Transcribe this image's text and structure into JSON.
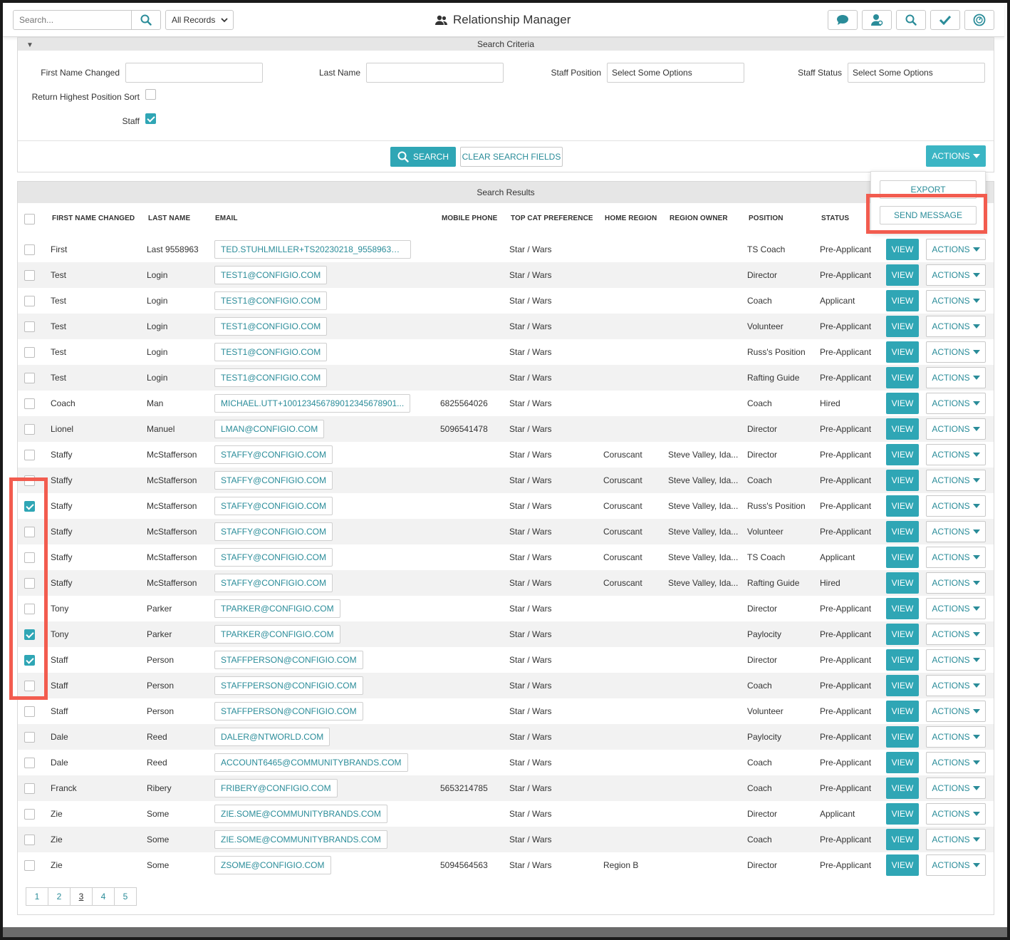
{
  "header": {
    "search_placeholder": "Search...",
    "records_select": "All Records",
    "title": "Relationship Manager",
    "icons": [
      "chat-icon",
      "user-icon",
      "search-icon",
      "check-icon",
      "dashboard-icon"
    ]
  },
  "criteria": {
    "title": "Search Criteria",
    "first_name_label": "First Name Changed",
    "first_name_value": "",
    "last_name_label": "Last Name",
    "last_name_value": "",
    "staff_position_label": "Staff Position",
    "staff_position_value": "Select Some Options",
    "staff_status_label": "Staff Status",
    "staff_status_value": "Select Some Options",
    "highest_position_label": "Return Highest Position Sort",
    "highest_position_checked": false,
    "staff_label": "Staff",
    "staff_checked": true,
    "search_button": "SEARCH",
    "clear_button": "CLEAR SEARCH FIELDS",
    "actions_button": "ACTIONS"
  },
  "actions_menu": {
    "export": "EXPORT",
    "send_message": "SEND MESSAGE"
  },
  "results": {
    "title": "Search Results",
    "columns": {
      "first_name": "FIRST NAME CHANGED",
      "last_name": "LAST NAME",
      "email": "EMAIL",
      "mobile": "MOBILE PHONE",
      "top_cat": "TOP CAT PREFERENCE",
      "home_region": "HOME REGION",
      "region_owner": "REGION OWNER",
      "position": "POSITION",
      "status": "STATUS"
    },
    "view_label": "VIEW",
    "actions_label": "ACTIONS",
    "rows": [
      {
        "checked": false,
        "first": "First",
        "last": "Last 9558963",
        "email": "TED.STUHLMILLER+TS20230218_9558963@C...",
        "mobile": "",
        "topcat": "Star / Wars",
        "region": "",
        "owner": "",
        "position": "TS Coach",
        "status": "Pre-Applicant"
      },
      {
        "checked": false,
        "first": "Test",
        "last": "Login",
        "email": "TEST1@CONFIGIO.COM",
        "mobile": "",
        "topcat": "Star / Wars",
        "region": "",
        "owner": "",
        "position": "Director",
        "status": "Pre-Applicant"
      },
      {
        "checked": false,
        "first": "Test",
        "last": "Login",
        "email": "TEST1@CONFIGIO.COM",
        "mobile": "",
        "topcat": "Star / Wars",
        "region": "",
        "owner": "",
        "position": "Coach",
        "status": "Applicant"
      },
      {
        "checked": false,
        "first": "Test",
        "last": "Login",
        "email": "TEST1@CONFIGIO.COM",
        "mobile": "",
        "topcat": "Star / Wars",
        "region": "",
        "owner": "",
        "position": "Volunteer",
        "status": "Pre-Applicant"
      },
      {
        "checked": false,
        "first": "Test",
        "last": "Login",
        "email": "TEST1@CONFIGIO.COM",
        "mobile": "",
        "topcat": "Star / Wars",
        "region": "",
        "owner": "",
        "position": "Russ's Position",
        "status": "Pre-Applicant"
      },
      {
        "checked": false,
        "first": "Test",
        "last": "Login",
        "email": "TEST1@CONFIGIO.COM",
        "mobile": "",
        "topcat": "Star / Wars",
        "region": "",
        "owner": "",
        "position": "Rafting Guide",
        "status": "Pre-Applicant"
      },
      {
        "checked": false,
        "first": "Coach",
        "last": "Man",
        "email": "MICHAEL.UTT+100123456789012345678901...",
        "mobile": "6825564026",
        "topcat": "Star / Wars",
        "region": "",
        "owner": "",
        "position": "Coach",
        "status": "Hired"
      },
      {
        "checked": false,
        "first": "Lionel",
        "last": "Manuel",
        "email": "LMAN@CONFIGIO.COM",
        "mobile": "5096541478",
        "topcat": "Star / Wars",
        "region": "",
        "owner": "",
        "position": "Director",
        "status": "Pre-Applicant"
      },
      {
        "checked": false,
        "first": "Staffy",
        "last": "McStafferson",
        "email": "STAFFY@CONFIGIO.COM",
        "mobile": "",
        "topcat": "Star / Wars",
        "region": "Coruscant",
        "owner": "Steve Valley, Ida...",
        "position": "Director",
        "status": "Pre-Applicant"
      },
      {
        "checked": false,
        "first": "Staffy",
        "last": "McStafferson",
        "email": "STAFFY@CONFIGIO.COM",
        "mobile": "",
        "topcat": "Star / Wars",
        "region": "Coruscant",
        "owner": "Steve Valley, Ida...",
        "position": "Coach",
        "status": "Pre-Applicant"
      },
      {
        "checked": true,
        "first": "Staffy",
        "last": "McStafferson",
        "email": "STAFFY@CONFIGIO.COM",
        "mobile": "",
        "topcat": "Star / Wars",
        "region": "Coruscant",
        "owner": "Steve Valley, Ida...",
        "position": "Russ's Position",
        "status": "Pre-Applicant"
      },
      {
        "checked": false,
        "first": "Staffy",
        "last": "McStafferson",
        "email": "STAFFY@CONFIGIO.COM",
        "mobile": "",
        "topcat": "Star / Wars",
        "region": "Coruscant",
        "owner": "Steve Valley, Ida...",
        "position": "Volunteer",
        "status": "Pre-Applicant"
      },
      {
        "checked": false,
        "first": "Staffy",
        "last": "McStafferson",
        "email": "STAFFY@CONFIGIO.COM",
        "mobile": "",
        "topcat": "Star / Wars",
        "region": "Coruscant",
        "owner": "Steve Valley, Ida...",
        "position": "TS Coach",
        "status": "Applicant"
      },
      {
        "checked": false,
        "first": "Staffy",
        "last": "McStafferson",
        "email": "STAFFY@CONFIGIO.COM",
        "mobile": "",
        "topcat": "Star / Wars",
        "region": "Coruscant",
        "owner": "Steve Valley, Ida...",
        "position": "Rafting Guide",
        "status": "Hired"
      },
      {
        "checked": false,
        "first": "Tony",
        "last": "Parker",
        "email": "TPARKER@CONFIGIO.COM",
        "mobile": "",
        "topcat": "Star / Wars",
        "region": "",
        "owner": "",
        "position": "Director",
        "status": "Pre-Applicant"
      },
      {
        "checked": true,
        "first": "Tony",
        "last": "Parker",
        "email": "TPARKER@CONFIGIO.COM",
        "mobile": "",
        "topcat": "Star / Wars",
        "region": "",
        "owner": "",
        "position": "Paylocity",
        "status": "Pre-Applicant"
      },
      {
        "checked": true,
        "first": "Staff",
        "last": "Person",
        "email": "STAFFPERSON@CONFIGIO.COM",
        "mobile": "",
        "topcat": "Star / Wars",
        "region": "",
        "owner": "",
        "position": "Director",
        "status": "Pre-Applicant"
      },
      {
        "checked": false,
        "first": "Staff",
        "last": "Person",
        "email": "STAFFPERSON@CONFIGIO.COM",
        "mobile": "",
        "topcat": "Star / Wars",
        "region": "",
        "owner": "",
        "position": "Coach",
        "status": "Pre-Applicant"
      },
      {
        "checked": false,
        "first": "Staff",
        "last": "Person",
        "email": "STAFFPERSON@CONFIGIO.COM",
        "mobile": "",
        "topcat": "Star / Wars",
        "region": "",
        "owner": "",
        "position": "Volunteer",
        "status": "Pre-Applicant"
      },
      {
        "checked": false,
        "first": "Dale",
        "last": "Reed",
        "email": "DALER@NTWORLD.COM",
        "mobile": "",
        "topcat": "Star / Wars",
        "region": "",
        "owner": "",
        "position": "Paylocity",
        "status": "Pre-Applicant"
      },
      {
        "checked": false,
        "first": "Dale",
        "last": "Reed",
        "email": "ACCOUNT6465@COMMUNITYBRANDS.COM",
        "mobile": "",
        "topcat": "Star / Wars",
        "region": "",
        "owner": "",
        "position": "Coach",
        "status": "Pre-Applicant"
      },
      {
        "checked": false,
        "first": "Franck",
        "last": "Ribery",
        "email": "FRIBERY@CONFIGIO.COM",
        "mobile": "5653214785",
        "topcat": "Star / Wars",
        "region": "",
        "owner": "",
        "position": "Coach",
        "status": "Pre-Applicant"
      },
      {
        "checked": false,
        "first": "Zie",
        "last": "Some",
        "email": "ZIE.SOME@COMMUNITYBRANDS.COM",
        "mobile": "",
        "topcat": "Star / Wars",
        "region": "",
        "owner": "",
        "position": "Director",
        "status": "Applicant"
      },
      {
        "checked": false,
        "first": "Zie",
        "last": "Some",
        "email": "ZIE.SOME@COMMUNITYBRANDS.COM",
        "mobile": "",
        "topcat": "Star / Wars",
        "region": "",
        "owner": "",
        "position": "Coach",
        "status": "Pre-Applicant"
      },
      {
        "checked": false,
        "first": "Zie",
        "last": "Some",
        "email": "ZSOME@CONFIGIO.COM",
        "mobile": "5094564563",
        "topcat": "Star / Wars",
        "region": "Region B",
        "owner": "",
        "position": "Director",
        "status": "Pre-Applicant"
      }
    ],
    "pages": [
      "1",
      "2",
      "3",
      "4",
      "5"
    ],
    "current_page": "3"
  },
  "colors": {
    "accent": "#2fa6b5",
    "link": "#2a8c99",
    "highlight": "#f25c4f"
  }
}
